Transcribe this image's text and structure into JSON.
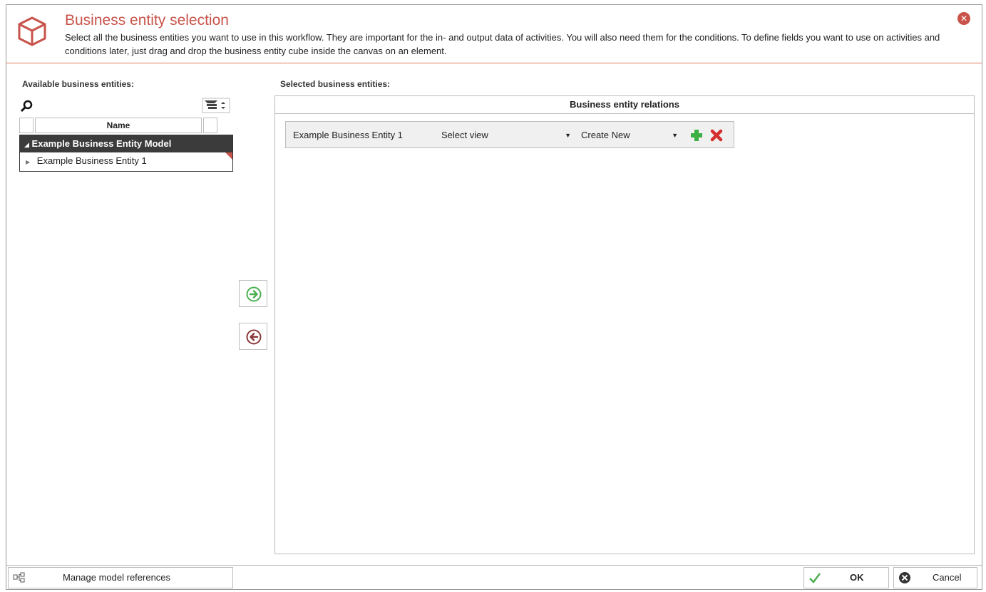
{
  "header": {
    "title": "Business entity selection",
    "description": "Select all the business entities you want to use in this workflow. They are important for the in- and output data of activities. You will also need them for the conditions. To define fields you want to use on activities and conditions later, just drag and drop the business entity cube inside the canvas on an element.",
    "accent_color": "#c8534a"
  },
  "available": {
    "label": "Available business entities:",
    "column_name": "Name",
    "group": "Example Business Entity Model",
    "items": [
      "Example Business Entity 1"
    ]
  },
  "selected": {
    "label": "Selected business entities:",
    "relations_header": "Business entity relations",
    "rows": [
      {
        "entity": "Example Business Entity 1",
        "view": "Select view",
        "relation": "Create New"
      }
    ]
  },
  "footer": {
    "manage_label": "Manage model references",
    "ok_label": "OK",
    "cancel_label": "Cancel"
  }
}
